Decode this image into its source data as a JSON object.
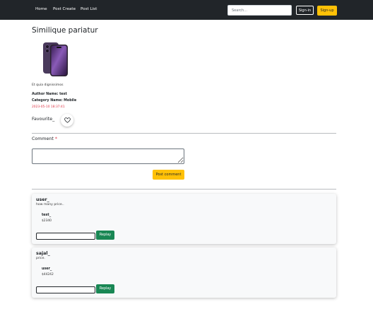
{
  "navbar": {
    "links": [
      "Home",
      "Post Create",
      "Post List"
    ],
    "search_placeholder": "Search...",
    "signin_label": "Sign-in",
    "signup_label": "Sign-up"
  },
  "post": {
    "title": "Similique pariatur",
    "image_icon": "phone-image",
    "description": "Et quia dignissimos",
    "author_label": "Author Name:",
    "author": "test",
    "category_label": "Category Name:",
    "category": "Mobile",
    "timestamp": "2023-05-10 18:37:41",
    "favourite_label": "Favourite_"
  },
  "comment_form": {
    "label": "Comment",
    "required_mark": "*",
    "value": "",
    "submit_label": "Post comment"
  },
  "comments": [
    {
      "user": "user_",
      "text": "how many price..",
      "reply": {
        "user": "test_",
        "text": "$2340"
      },
      "reply_input_value": "",
      "reply_button": "Replay"
    },
    {
      "user": "sajal_",
      "text": "price.",
      "reply": {
        "user": "user_",
        "text": "$44242"
      },
      "reply_input_value": "",
      "reply_button": "Replay"
    }
  ],
  "colors": {
    "navbar": "#212529",
    "warning": "#ffc107",
    "success": "#198754",
    "danger": "#dc3545"
  }
}
